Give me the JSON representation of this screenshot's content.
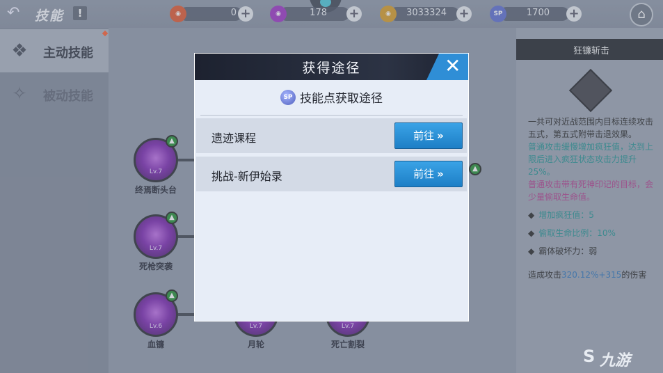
{
  "header": {
    "title": "技能",
    "info_label": "!",
    "resources": [
      {
        "icon": "fire-coin-icon",
        "value": "0",
        "color": "#e0542a"
      },
      {
        "icon": "purple-gem-icon",
        "value": "178",
        "color": "#9b2fc4"
      },
      {
        "icon": "gold-coin-icon",
        "value": "3033324",
        "color": "#d89a1f"
      },
      {
        "icon": "sp-icon",
        "label": "SP",
        "value": "1700",
        "color": "#5a6ad0"
      }
    ],
    "plus_label": "+"
  },
  "tabs": [
    {
      "label": "主动技能",
      "active": true
    },
    {
      "label": "被动技能",
      "active": false
    }
  ],
  "skill_nodes": [
    {
      "name": "终焉断头台",
      "level": "Lv.7"
    },
    {
      "name": "死枪突袭",
      "level": "Lv.7"
    },
    {
      "name": "血镰",
      "level": "Lv.6"
    },
    {
      "name": "月轮",
      "level": "Lv.7"
    },
    {
      "name": "死亡割裂",
      "level": "Lv.7"
    }
  ],
  "detail": {
    "title": "狂镰斩击",
    "desc": "一共可对近战范围内目标连续攻击五式，第五式附带击退效果。",
    "desc_teal": "普通攻击缓慢增加疯狂值，达到上限后进入疯狂状态攻击力提升25%。",
    "desc_magenta": "普通攻击带有死神印记的目标，会少量偷取生命值。",
    "stats": [
      {
        "label": "增加疯狂值：5",
        "color": "#1e8f8f"
      },
      {
        "label": "偷取生命比例：10%",
        "color": "#1e8f8f"
      },
      {
        "label": "霸体破坏力：弱",
        "color": "#222222"
      }
    ],
    "damage_prefix": "造成攻击",
    "damage_value": "320.12%+315",
    "damage_suffix": "的伤害"
  },
  "modal": {
    "title": "获得途径",
    "close_label": "✕",
    "subtitle": "技能点获取途径",
    "sp_label": "SP",
    "rows": [
      {
        "label": "遗迹课程",
        "button": "前往"
      },
      {
        "label": "挑战-新伊始录",
        "button": "前往"
      }
    ],
    "button_arrow": "»"
  },
  "watermark": "九游"
}
